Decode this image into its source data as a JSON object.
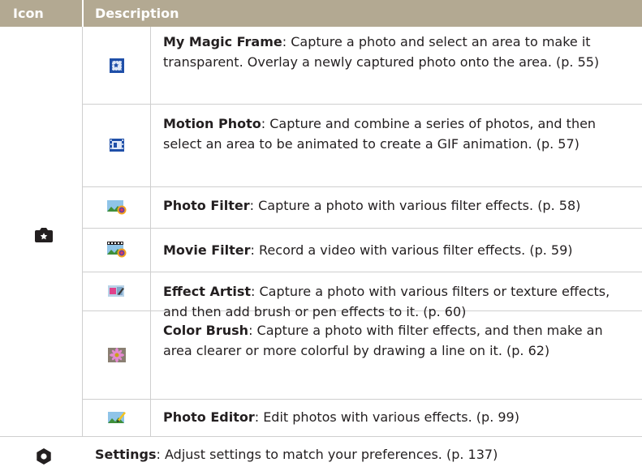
{
  "header": {
    "icon_label": "Icon",
    "description_label": "Description"
  },
  "modes": [
    {
      "name": "My Magic Frame",
      "text": ": Capture a photo and select an area to make it transparent. Overlay a newly captured photo onto the area. (p. 55)",
      "icon": "magic-frame-icon"
    },
    {
      "name": "Motion Photo",
      "text": ": Capture and combine a series of photos, and then select an area to be animated to create a GIF animation. (p. 57)",
      "icon": "motion-photo-icon"
    },
    {
      "name": "Photo Filter",
      "text": ": Capture a photo with various filter effects. (p. 58)",
      "icon": "photo-filter-icon"
    },
    {
      "name": "Movie Filter",
      "text": ": Record a video with various filter effects. (p. 59)",
      "icon": "movie-filter-icon"
    },
    {
      "name": "Effect Artist",
      "text": ": Capture a photo with various filters or texture effects, and then add brush or pen effects to it. (p. 60)",
      "icon": "effect-artist-icon"
    },
    {
      "name": "Color Brush",
      "text": ": Capture a photo with filter effects, and then make an area clearer or more colorful by drawing a line on it. (p. 62)",
      "icon": "color-brush-icon"
    },
    {
      "name": "Photo Editor",
      "text": ": Edit photos with various effects. (p. 99)",
      "icon": "photo-editor-icon"
    }
  ],
  "group_icon": "camera-star-icon",
  "settings": {
    "name": "Settings",
    "text": ": Adjust settings to match your preferences. (p. 137)",
    "icon": "gear-icon"
  },
  "colors": {
    "header_bg": "#b3a992",
    "grid": "#cfcfcf",
    "text": "#231f20"
  }
}
